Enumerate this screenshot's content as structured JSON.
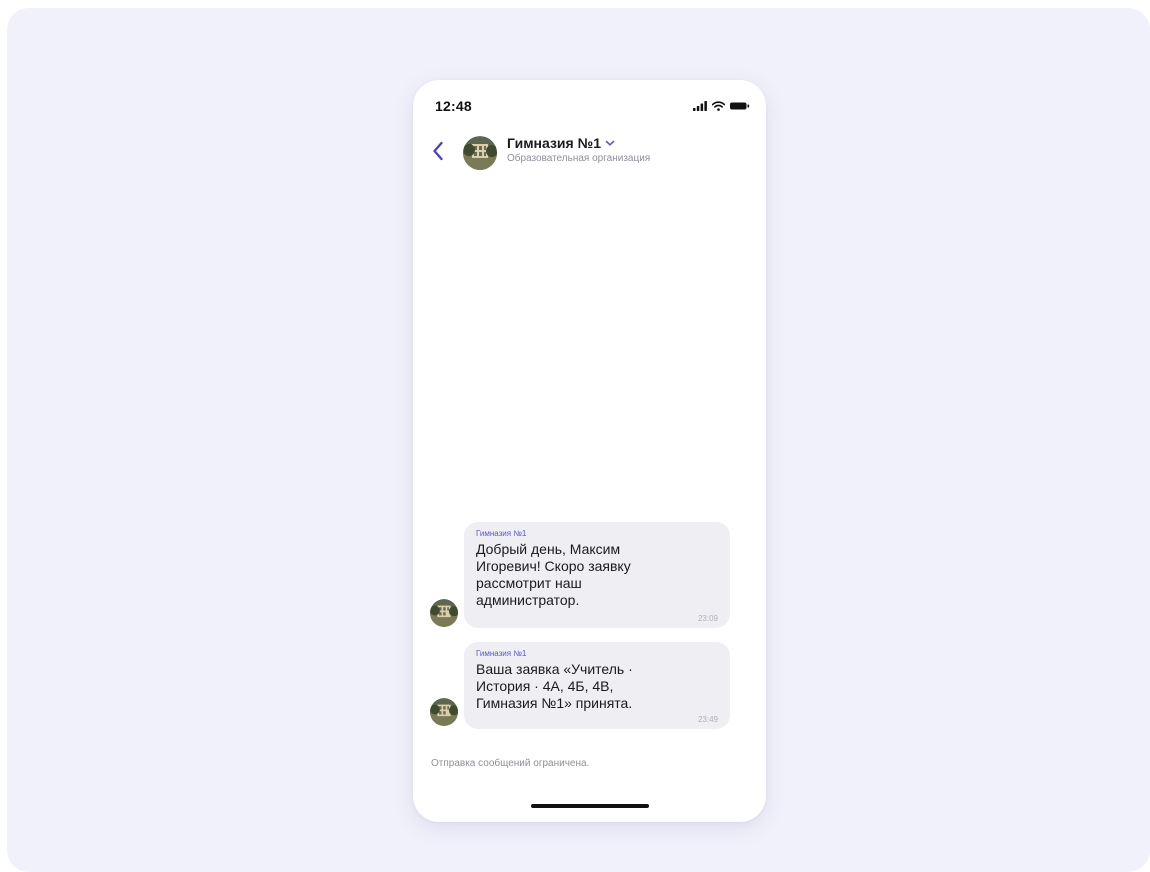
{
  "status_bar": {
    "time": "12:48"
  },
  "header": {
    "back_icon": "chevron-left-icon",
    "chat_name": "Гимназия №1",
    "dropdown_icon": "chevron-down-icon",
    "subtitle": "Образовательная организация"
  },
  "messages": [
    {
      "sender": "Гимназия №1",
      "text": "Добрый день, Максим Игоревич! Скоро заявку рассмотрит наш администратор.",
      "time": "23:09"
    },
    {
      "sender": "Гимназия №1",
      "text": "Ваша заявка «Учитель · История · 4А, 4Б, 4В, Гимназия №1» принята.",
      "time": "23:49"
    }
  ],
  "footer": {
    "restricted_note": "Отправка сообщений ограничена."
  },
  "colors": {
    "accent": "#5b57c9",
    "background": "#f1f1fb",
    "bubble": "#eeeef3"
  }
}
